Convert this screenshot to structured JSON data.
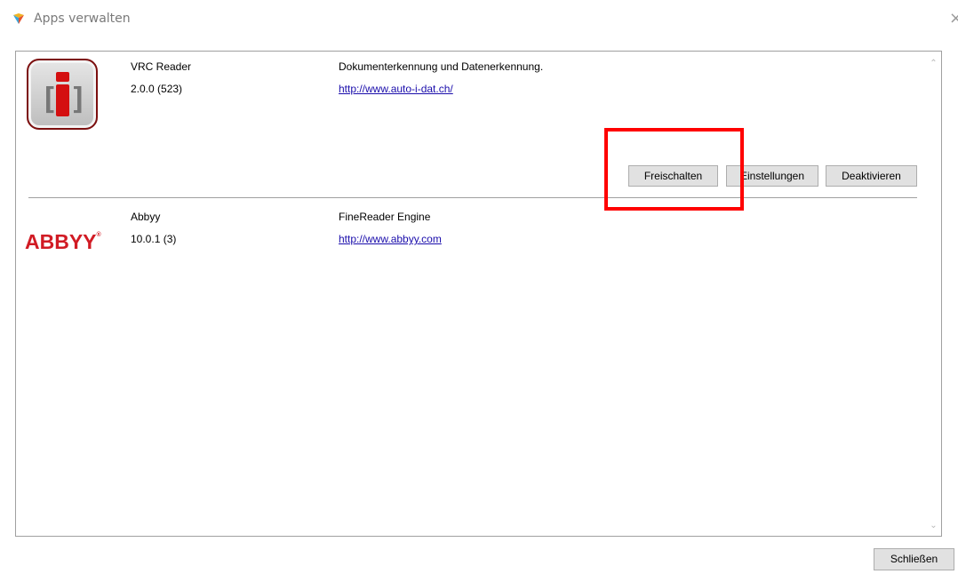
{
  "window": {
    "title": "Apps verwalten",
    "icon": "app-icon",
    "close_glyph": "×"
  },
  "apps": [
    {
      "name": "VRC Reader",
      "version": "2.0.0 (523)",
      "description": "Dokumenterkennung und Datenerkennung.",
      "link": "http://www.auto-i-dat.ch/",
      "buttons": [
        "Freischalten",
        "Einstellungen",
        "Deaktivieren"
      ]
    },
    {
      "name": "Abbyy",
      "version": "10.0.1 (3)",
      "description": "FineReader Engine",
      "link": "http://www.abbyy.com",
      "logo_text": "ABBYY",
      "logo_mark": "®"
    }
  ],
  "footer": {
    "close_label": "Schließen"
  },
  "colors": {
    "highlight": "#ff0000",
    "link": "#1a0dab",
    "abbyy_red": "#d11b24",
    "vrc_red": "#d40f10"
  }
}
